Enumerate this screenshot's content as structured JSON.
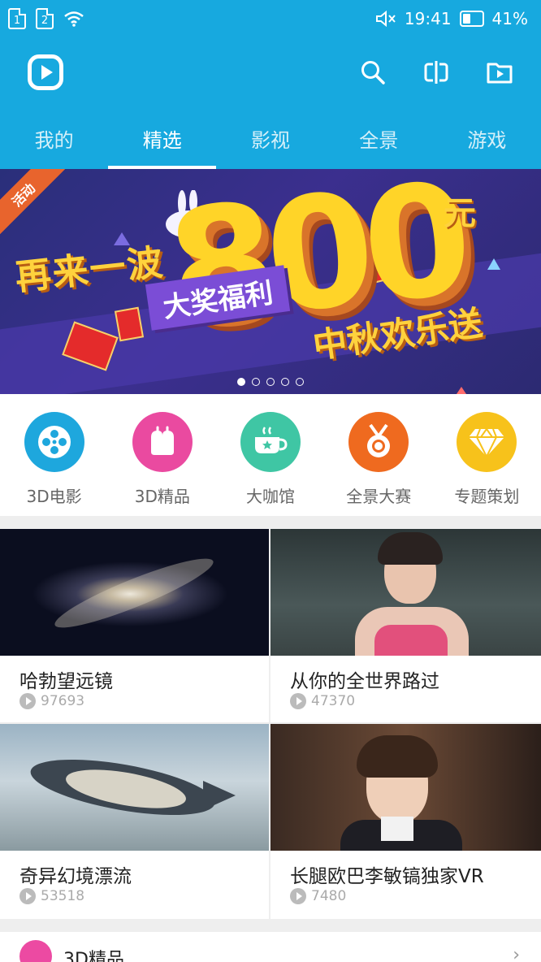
{
  "status_bar": {
    "sim1": "1",
    "sim2": "2",
    "time": "19:41",
    "battery": "41%",
    "battery_level": 0.41
  },
  "app_bar": {
    "logo_icon": "app-logo-icon",
    "actions": [
      "search-icon",
      "cast-icon",
      "local-video-icon"
    ]
  },
  "tabs": [
    "我的",
    "精选",
    "影视",
    "全景",
    "游戏"
  ],
  "active_tab": 1,
  "banner": {
    "ribbon": "活动",
    "line1": "再来一波",
    "amount": "800",
    "unit": "元",
    "pill": "大奖福利",
    "line3": "中秋欢乐送",
    "slide_count": 5,
    "active_slide": 0
  },
  "categories": [
    {
      "label": "3D电影",
      "icon": "film-reel-icon",
      "color": "#1ea7dd"
    },
    {
      "label": "3D精品",
      "icon": "gift-icon",
      "color": "#ea4aa0"
    },
    {
      "label": "大咖馆",
      "icon": "coffee-cup-icon",
      "color": "#3fc6a4"
    },
    {
      "label": "全景大赛",
      "icon": "medal-icon",
      "color": "#ef6a1f"
    },
    {
      "label": "专题策划",
      "icon": "diamond-icon",
      "color": "#f7c21b"
    }
  ],
  "videos": [
    {
      "title": "哈勃望远镜",
      "views": "97693"
    },
    {
      "title": "从你的全世界路过",
      "views": "47370"
    },
    {
      "title": "奇异幻境漂流",
      "views": "53518"
    },
    {
      "title": "长腿欧巴李敏镐独家VR",
      "views": "7480"
    }
  ],
  "bottom_section": {
    "title": "3D精品",
    "more": "›"
  }
}
